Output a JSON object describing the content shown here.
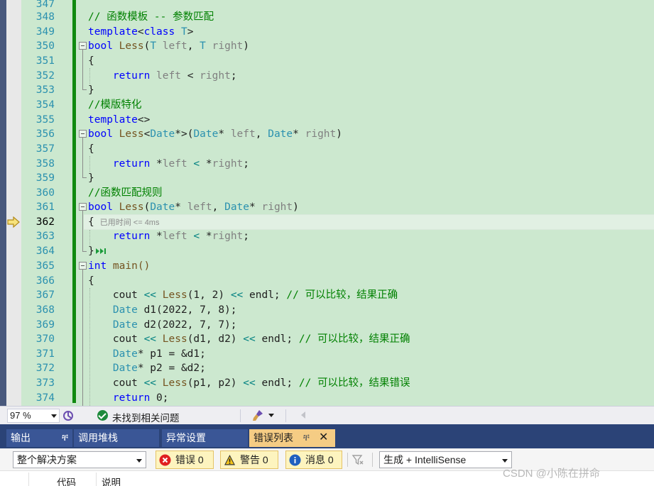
{
  "editor": {
    "first_line_number": 347,
    "current_line_number": 362,
    "line_numbers": [
      "347",
      "348",
      "349",
      "350",
      "351",
      "352",
      "353",
      "354",
      "355",
      "356",
      "357",
      "358",
      "359",
      "360",
      "361",
      "362",
      "363",
      "364",
      "365",
      "366",
      "367",
      "368",
      "369",
      "370",
      "371",
      "372",
      "373",
      "374"
    ],
    "elapsed_hint": "已用时间 <= 4ms",
    "code": {
      "l348_comment": "// 函数模板 -- 参数匹配",
      "l349_kw": "template",
      "l349_lt": "<",
      "l349_class": "class",
      "l349_T": " T",
      "l349_gt": ">",
      "l350_bool": "bool",
      "l350_fn": " Less",
      "l350_a": "(",
      "l350_T1": "T",
      "l350_p1": " left",
      "l350_b": ", ",
      "l350_T2": "T",
      "l350_p2": " right",
      "l350_c": ")",
      "l351": "{",
      "l352_ret": "    return",
      "l352_p1": " left",
      "l352_op": " < ",
      "l352_p2": "right",
      "l352_end": ";",
      "l353": "}",
      "l354_comment": "//模版特化",
      "l355_kw": "template",
      "l355_rest": "<>",
      "l356_bool": "bool",
      "l356_fn": " Less",
      "l356_lt": "<",
      "l356_date": "Date",
      "l356_ptr": "*>",
      "l356_a": "(",
      "l356_T1": "Date",
      "l356_p1a": "* ",
      "l356_p1": "left",
      "l356_b": ", ",
      "l356_T2": "Date",
      "l356_p2a": "* ",
      "l356_p2": "right",
      "l356_c": ")",
      "l357": "{",
      "l358_ret": "    return",
      "l358_s1": " *",
      "l358_p1": "left",
      "l358_op": " < ",
      "l358_s2": "*",
      "l358_p2": "right",
      "l358_end": ";",
      "l359": "}",
      "l360_comment": "//函数匹配规则",
      "l361_bool": "bool",
      "l361_fn": " Less",
      "l361_a": "(",
      "l361_T1": "Date",
      "l361_p1a": "* ",
      "l361_p1": "left",
      "l361_b": ", ",
      "l361_T2": "Date",
      "l361_p2a": "* ",
      "l361_p2": "right",
      "l361_c": ")",
      "l362": "{",
      "l363_ret": "    return",
      "l363_s1": " *",
      "l363_p1": "left",
      "l363_op": " < ",
      "l363_s2": "*",
      "l363_p2": "right",
      "l363_end": ";",
      "l364": "}",
      "l365_kw": "int",
      "l365_rest": " main()",
      "l366": "{",
      "l367_a": "    cout ",
      "l367_op1": "<<",
      "l367_fn": " Less",
      "l367_b": "(1, 2) ",
      "l367_op2": "<<",
      "l367_c": " endl; ",
      "l367_cm": "// 可以比较，结果正确",
      "l368_ty": "    Date",
      "l368_rest": " d1(2022, 7, 8);",
      "l369_ty": "    Date",
      "l369_rest": " d2(2022, 7, 7);",
      "l370_a": "    cout ",
      "l370_op1": "<<",
      "l370_fn": " Less",
      "l370_b": "(d1, d2) ",
      "l370_op2": "<<",
      "l370_c": " endl; ",
      "l370_cm": "// 可以比较，结果正确",
      "l371_ty": "    Date",
      "l371_rest": "* p1 = &d1;",
      "l372_ty": "    Date",
      "l372_rest": "* p2 = &d2;",
      "l373_a": "    cout ",
      "l373_op1": "<<",
      "l373_fn": " Less",
      "l373_b": "(p1, p2) ",
      "l373_op2": "<<",
      "l373_c": " endl; ",
      "l373_cm": "// 可以比较，结果错误",
      "l374_kw": "    return",
      "l374_rest": " 0;"
    }
  },
  "status_bar": {
    "zoom": "97 %",
    "issues_text": "未找到相关问题"
  },
  "tool_tabs": [
    {
      "label": "输出",
      "pin": "ቸ"
    },
    {
      "label": "调用堆栈"
    },
    {
      "label": "异常设置"
    },
    {
      "label": "错误列表",
      "pin": "ቸ",
      "close": "✕"
    }
  ],
  "error_list": {
    "scope": "整个解决方案",
    "errors_label": "错误 0",
    "warnings_label": "警告 0",
    "messages_label": "消息 0",
    "build_filter": "生成 + IntelliSense",
    "columns": [
      "代码",
      "说明"
    ]
  },
  "watermark": "CSDN @﻿﻿小陈在拼命﻿﻿",
  "colors": {
    "editor_bg": "#cce8cf",
    "change_bar": "#108a10",
    "keyword": "#0000ff",
    "type": "#2b91af",
    "comment": "#008000",
    "active_tab": "#f5cc84",
    "tab_strip": "#2b4377"
  }
}
